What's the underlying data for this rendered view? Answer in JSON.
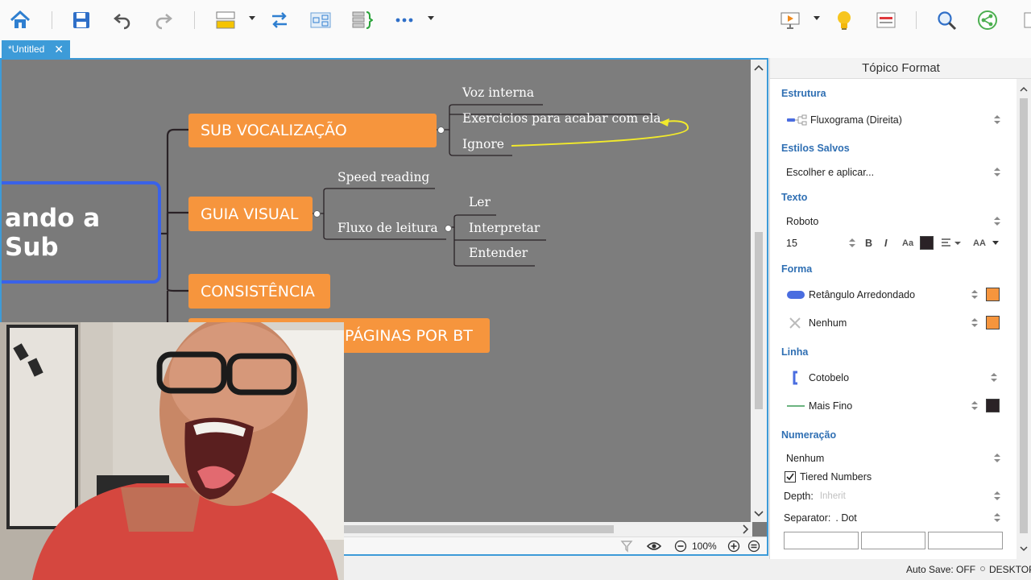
{
  "toolbar": {
    "items": [
      "home-icon",
      "save-icon",
      "undo-icon",
      "redo-icon",
      "topic-layout-icon",
      "relationship-icon",
      "boundary-icon",
      "summary-icon",
      "more-icon",
      "presentation-icon",
      "idea-icon",
      "format-panel-icon",
      "search-icon",
      "share-icon"
    ]
  },
  "tab": {
    "label": "*Untitled",
    "close": "✕"
  },
  "canvas": {
    "central": "ando a Sub",
    "topics": [
      {
        "label": "SUB VOCALIZAÇÃO"
      },
      {
        "label": "GUIA VISUAL"
      },
      {
        "label": "CONSISTÊNCIA"
      },
      {
        "label": "PÁGINAS POR BT"
      }
    ],
    "leaves": {
      "voz": "Voz interna",
      "exercicios": "Exercicios para acabar com ela",
      "ignore": "Ignore",
      "speed": "Speed reading",
      "fluxo": "Fluxo de leitura",
      "ler": "Ler",
      "interpretar": "Interpretar",
      "entender": "Entender"
    },
    "zoom": "100%",
    "arrow_color": "#f2ea2b",
    "topic_color": "#f6953d",
    "central_border_color": "#3a62e8"
  },
  "panel": {
    "title": "Tópico Format",
    "estrutura": {
      "label": "Estrutura",
      "value": "Fluxograma (Direita)"
    },
    "estilos": {
      "label": "Estilos Salvos",
      "value": "Escolher e aplicar..."
    },
    "texto": {
      "label": "Texto",
      "font": "Roboto",
      "size": "15",
      "bold": "B",
      "italic": "I",
      "case": "Aa",
      "caps": "AA",
      "color": "#2a2226"
    },
    "forma": {
      "label": "Forma",
      "shape": "Retângulo Arredondado",
      "border": "Nenhum",
      "fill_color": "#f6953d",
      "border_color": "#f6953d"
    },
    "linha": {
      "label": "Linha",
      "style": "Cotobelo",
      "width": "Mais Fino",
      "color": "#2a2226"
    },
    "numeracao": {
      "label": "Numeração",
      "value": "Nenhum",
      "tiered": "Tiered Numbers",
      "tiered_checked": true,
      "depth_label": "Depth:",
      "depth_value": "Inherit",
      "separator_label": "Separator:",
      "separator_value": ". Dot"
    }
  },
  "status": {
    "autosave": "Auto Save: OFF",
    "device": "DESKTOP-"
  }
}
